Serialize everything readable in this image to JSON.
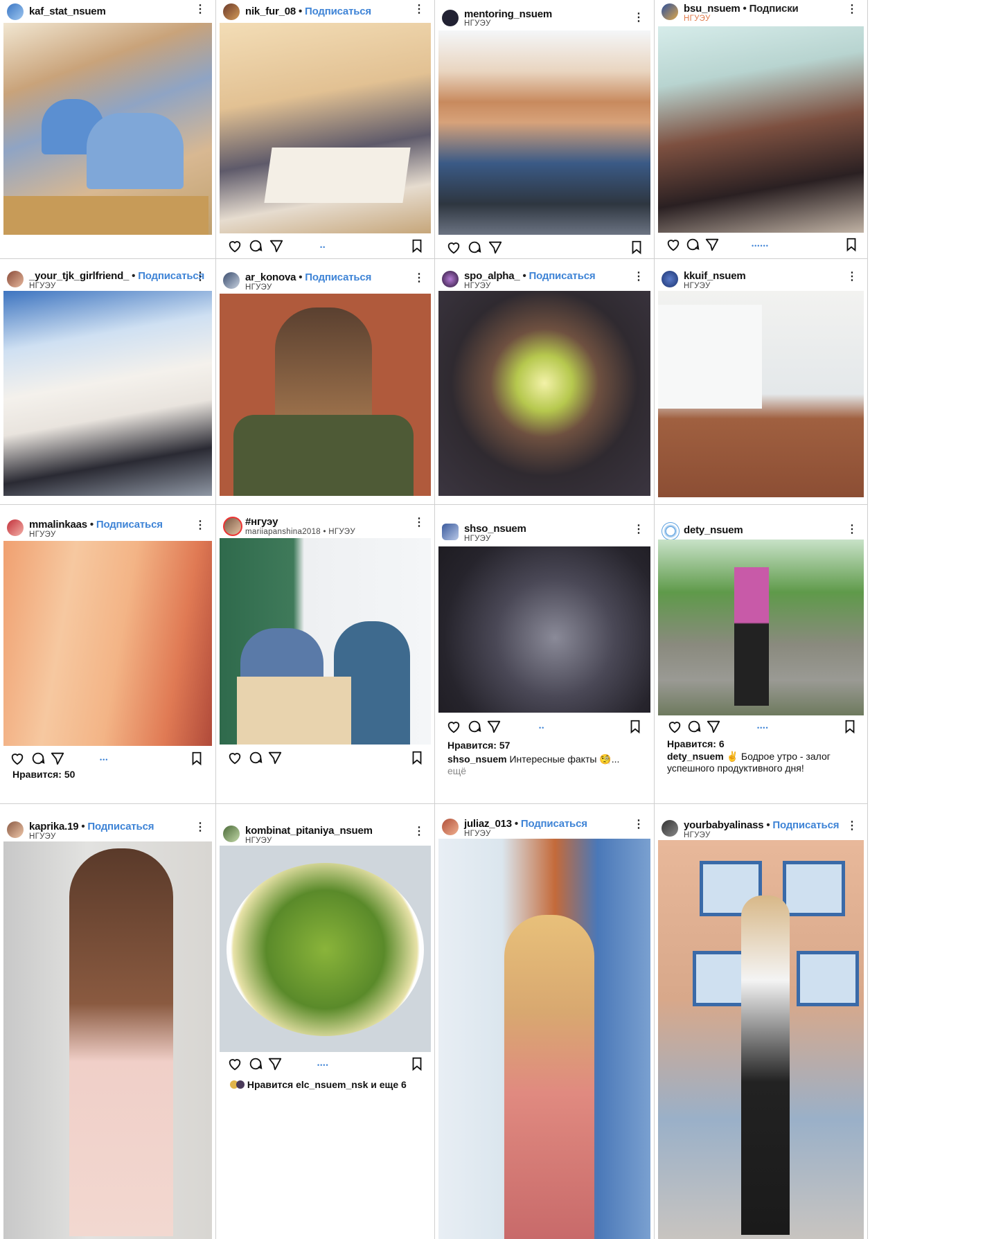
{
  "posts": [
    {
      "user": "kaf_stat_nsuem",
      "follow": "",
      "location": ""
    },
    {
      "user": "nik_fur_08",
      "follow": "Подписаться",
      "location": ""
    },
    {
      "user": "mentoring_nsuem",
      "follow": "",
      "location": "НГУЭУ"
    },
    {
      "user": "bsu_nsuem",
      "follow": "Подписки",
      "location": "НГУЭУ"
    },
    {
      "user": "_your_tjk_girlfriend_",
      "follow": "Подписаться",
      "location": "НГУЭУ"
    },
    {
      "user": "ar_konova",
      "follow": "Подписаться",
      "location": "НГУЭУ"
    },
    {
      "user": "spo_alpha_",
      "follow": "Подписаться",
      "location": "НГУЭУ"
    },
    {
      "user": "kkuif_nsuem",
      "follow": "",
      "location": "НГУЭУ"
    },
    {
      "user": "mmalinkaas",
      "follow": "Подписаться",
      "location": "НГУЭУ",
      "likes": "Нравится: 50"
    },
    {
      "user": "#нгуэу",
      "follow": "",
      "location": "mariiapanshina2018 • НГУЭУ"
    },
    {
      "user": "shso_nsuem",
      "follow": "",
      "location": "НГУЭУ",
      "likes": "Нравится: 57",
      "caption_user": "shso_nsuem",
      "caption": "Интересные факты 🧐...",
      "caption_more": "ещё"
    },
    {
      "user": "dety_nsuem",
      "follow": "",
      "location": "",
      "likes": "Нравится: 6",
      "caption_user": "dety_nsuem",
      "caption": "✌️ Бодрое утро - залог успешного продуктивного дня!"
    },
    {
      "user": "kaprika.19",
      "follow": "Подписаться",
      "location": "НГУЭУ"
    },
    {
      "user": "kombinat_pitaniya_nsuem",
      "follow": "",
      "location": "НГУЭУ",
      "liked_by_prefix": "Нравится",
      "liked_by_user": "elc_nsuem_nsk",
      "liked_by_suffix": "и еще 6"
    },
    {
      "user": "juliaz_013",
      "follow": "Подписаться",
      "location": "НГУЭУ"
    },
    {
      "user": "yourbabyalinass",
      "follow": "Подписаться",
      "location": "НГУЭУ"
    }
  ],
  "bullet": "•",
  "more_glyph": "⋮",
  "icons": {
    "like": "heart-icon",
    "comment": "comment-icon",
    "share": "send-icon",
    "save": "bookmark-icon",
    "more": "more-vertical-icon"
  },
  "colors": {
    "link": "#3f84d6",
    "divider": "#cfcfcf",
    "text": "#111111"
  }
}
